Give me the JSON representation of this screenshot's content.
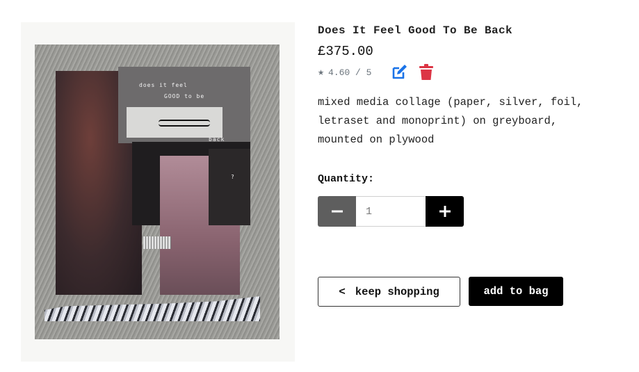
{
  "product": {
    "title": "Does It Feel Good To Be Back",
    "price": "£375.00",
    "rating": "4.60 / 5",
    "description": "mixed media collage (paper, silver, foil, letraset and monoprint) on greyboard, mounted on plywood"
  },
  "image": {
    "alt_text_lines": [
      "does it feel",
      "GOOD to be",
      "back",
      "?"
    ]
  },
  "icons": {
    "star": "star-icon",
    "edit": "edit-icon",
    "delete": "trash-icon",
    "minus": "minus-icon",
    "plus": "plus-icon",
    "chevron": "chevron-left-icon"
  },
  "colors": {
    "edit": "#1a73e8",
    "delete": "#dc3545",
    "rating": "#6c757d"
  },
  "quantity": {
    "label": "Quantity:",
    "value": "1"
  },
  "actions": {
    "keep_shopping": "keep shopping",
    "add_to_bag": "add to bag"
  }
}
